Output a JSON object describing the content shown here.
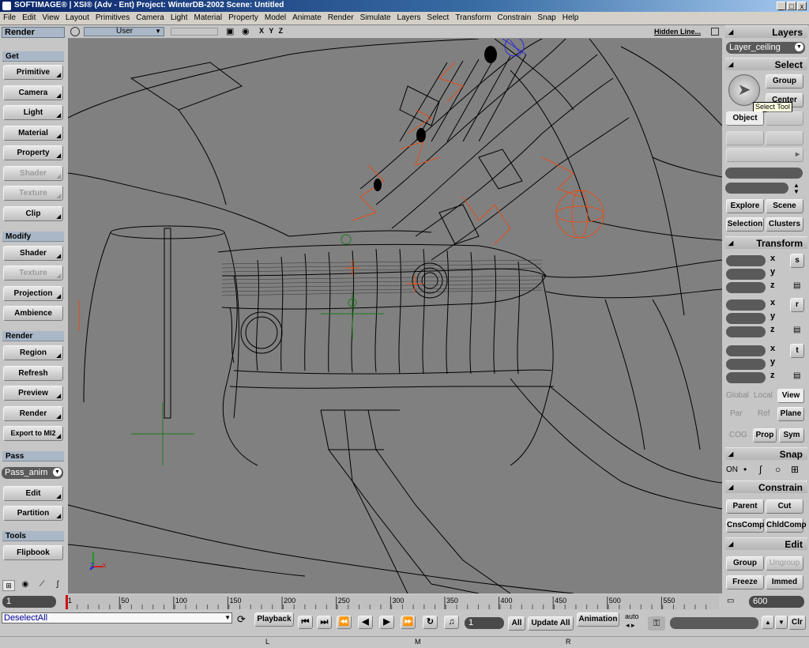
{
  "window": {
    "title": "SOFTIMAGE® | XSI® (Adv - Ent) Project: WinterDB-2002    Scene: Untitled",
    "controls": [
      "_",
      "□",
      "x"
    ]
  },
  "menu": [
    "File",
    "Edit",
    "View",
    "Layout",
    "Primitives",
    "Camera",
    "Light",
    "Material",
    "Property",
    "Model",
    "Animate",
    "Render",
    "Simulate",
    "Layers",
    "Select",
    "Transform",
    "Constrain",
    "Snap",
    "Help"
  ],
  "left": {
    "module": "Render",
    "get_header": "Get",
    "get_items": [
      {
        "label": "Primitive",
        "enabled": true
      },
      {
        "label": "Camera",
        "enabled": true
      },
      {
        "label": "Light",
        "enabled": true
      },
      {
        "label": "Material",
        "enabled": true
      },
      {
        "label": "Property",
        "enabled": true
      },
      {
        "label": "Shader",
        "enabled": false
      },
      {
        "label": "Texture",
        "enabled": false
      },
      {
        "label": "Clip",
        "enabled": true
      }
    ],
    "modify_header": "Modify",
    "modify_items": [
      {
        "label": "Shader",
        "enabled": true
      },
      {
        "label": "Texture",
        "enabled": false
      },
      {
        "label": "Projection",
        "enabled": true
      },
      {
        "label": "Ambience",
        "enabled": true
      }
    ],
    "render_header": "Render",
    "render_items": [
      {
        "label": "Region",
        "enabled": true
      },
      {
        "label": "Refresh",
        "enabled": true
      },
      {
        "label": "Preview",
        "enabled": true
      },
      {
        "label": "Render",
        "enabled": true
      },
      {
        "label": "Export to MI2",
        "enabled": true
      }
    ],
    "pass_header": "Pass",
    "pass_value": "Pass_anim",
    "pass_items": [
      {
        "label": "Edit",
        "enabled": true
      },
      {
        "label": "Partition",
        "enabled": true
      }
    ],
    "tools_header": "Tools",
    "tools_items": [
      {
        "label": "Flipbook",
        "enabled": true
      }
    ]
  },
  "viewport": {
    "camera": "User",
    "axes": "X Y Z",
    "display_mode": "Hidden Line...",
    "axis_x": "X",
    "axis_z": "Z",
    "wire_color": "#000000",
    "bg_color": "#808080",
    "selection_color": "#e0501a",
    "light_color": "#2a2ad8"
  },
  "right": {
    "layers_header": "Layers",
    "layer_value": "Layer_ceiling",
    "select_header": "Select",
    "group_label": "Group",
    "center_label": "Center",
    "tooltip": "Select Tool",
    "object_label": "Object",
    "explore_label": "Explore",
    "scene_label": "Scene",
    "selection_label": "Selection",
    "clusters_label": "Clusters",
    "transform_header": "Transform",
    "axis_labels": [
      "x",
      "y",
      "z"
    ],
    "transform_icons": [
      "s",
      "r",
      "t"
    ],
    "global_label": "Global",
    "local_label": "Local",
    "view_label": "View",
    "par_label": "Par",
    "ref_label": "Ref",
    "plane_label": "Plane",
    "cog_label": "COG",
    "prop_label": "Prop",
    "sym_label": "Sym",
    "snap_header": "Snap",
    "snap_on": "ON",
    "constrain_header": "Constrain",
    "parent_label": "Parent",
    "cut_label": "Cut",
    "cnscomp_label": "CnsComp",
    "chldcomp_label": "ChldComp",
    "edit_header": "Edit",
    "egroup_label": "Group",
    "ungroup_label": "Ungroup",
    "freeze_label": "Freeze",
    "immed_label": "Immed"
  },
  "timeline": {
    "start": "1",
    "end": "600",
    "ticks": [
      "1",
      "50",
      "100",
      "150",
      "200",
      "250",
      "300",
      "350",
      "400",
      "450",
      "500",
      "550"
    ]
  },
  "command": {
    "script_value": "DeselectAll",
    "playback_label": "Playback",
    "frame_value": "1",
    "all_label": "All",
    "update_label": "Update All",
    "animation_label": "Animation",
    "auto_label": "auto",
    "clr_label": "Clr",
    "mouse_l": "L",
    "mouse_m": "M",
    "mouse_r": "R"
  }
}
